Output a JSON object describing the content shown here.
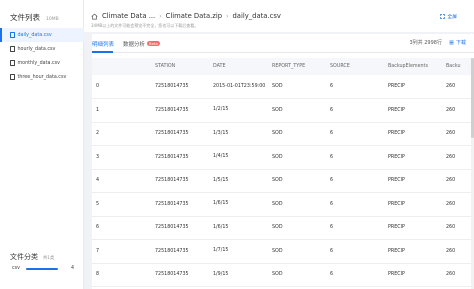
{
  "sidebar": {
    "title": "文件列表",
    "size": "10MB",
    "files": [
      {
        "name": "daily_data.csv",
        "active": true
      },
      {
        "name": "hourly_data.csv",
        "active": false
      },
      {
        "name": "monthly_data.csv",
        "active": false
      },
      {
        "name": "three_hour_data.csv",
        "active": false
      }
    ],
    "category": {
      "title": "文件分类",
      "count": "共1类",
      "label": "csv",
      "value": "4",
      "fill_fraction": 1.0
    }
  },
  "header": {
    "breadcrumb": [
      "Climate Data ...",
      "Climate Data.zip",
      "daily_data.csv"
    ],
    "note": "34MB以上的文件可能会预览不完全，您也可以下载后查看。",
    "fullscreen_label": "全屏"
  },
  "panel": {
    "tabs": [
      {
        "label": "明细列表",
        "active": true
      },
      {
        "label": "数据分析",
        "badge": "Beta",
        "active": false
      }
    ],
    "meta_text": "3列共 2998行",
    "download_label": "下载",
    "columns": [
      "",
      "STATION",
      "DATE",
      "REPORT_TYPE",
      "SOURCE",
      "BackupElements",
      "Backu"
    ],
    "rows": [
      [
        "0",
        "72518014735",
        "2015-01-01T23:59:00",
        "SOD",
        "6",
        "PRECIP",
        "260"
      ],
      [
        "1",
        "72518014735",
        "1/2/15",
        "SOD",
        "6",
        "PRECIP",
        "260"
      ],
      [
        "2",
        "72518014735",
        "1/3/15",
        "SOD",
        "6",
        "PRECIP",
        "260"
      ],
      [
        "3",
        "72518014735",
        "1/4/15",
        "SOD",
        "6",
        "PRECIP",
        "260"
      ],
      [
        "4",
        "72518014735",
        "1/5/15",
        "SOD",
        "6",
        "PRECIP",
        "260"
      ],
      [
        "5",
        "72518014735",
        "1/6/15",
        "SOD",
        "6",
        "PRECIP",
        "260"
      ],
      [
        "6",
        "72518014735",
        "1/6/15",
        "SOD",
        "6",
        "PRECIP",
        "260"
      ],
      [
        "7",
        "72518014735",
        "1/7/15",
        "SOD",
        "6",
        "PRECIP",
        "260"
      ],
      [
        "8",
        "72518014735",
        "1/9/15",
        "SOD",
        "6",
        "PRECIP",
        "260"
      ]
    ]
  },
  "colors": {
    "accent": "#1a73e8",
    "badge": "#f56c6c"
  }
}
